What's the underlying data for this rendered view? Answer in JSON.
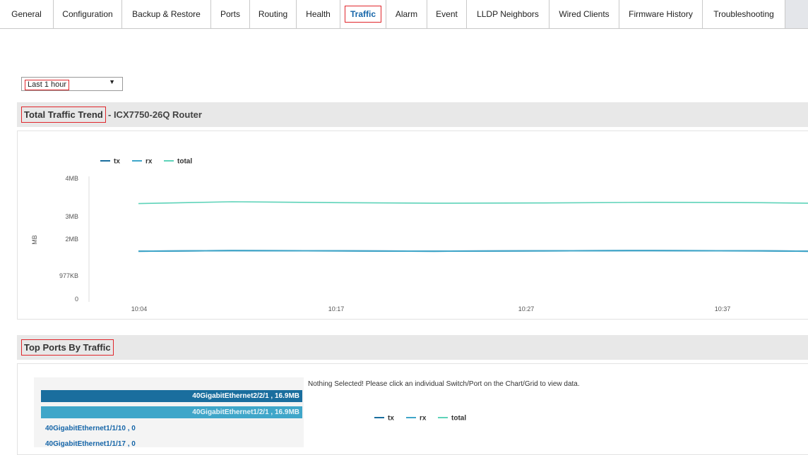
{
  "tabs": [
    {
      "label": "General",
      "active": false
    },
    {
      "label": "Configuration",
      "active": false
    },
    {
      "label": "Backup & Restore",
      "active": false
    },
    {
      "label": "Ports",
      "active": false
    },
    {
      "label": "Routing",
      "active": false
    },
    {
      "label": "Health",
      "active": false
    },
    {
      "label": "Traffic",
      "active": true
    },
    {
      "label": "Alarm",
      "active": false
    },
    {
      "label": "Event",
      "active": false
    },
    {
      "label": "LLDP Neighbors",
      "active": false
    },
    {
      "label": "Wired Clients",
      "active": false
    },
    {
      "label": "Firmware History",
      "active": false
    },
    {
      "label": "Troubleshooting",
      "active": false
    }
  ],
  "time_range": {
    "value": "Last 1 hour"
  },
  "traffic_trend": {
    "title": "Total Traffic Trend",
    "subtitle": "- ICX7750-26Q Router"
  },
  "top_ports": {
    "title": "Top Ports By Traffic",
    "message": "Nothing Selected! Please click an individual Switch/Port on the Chart/Grid to view data.",
    "ports": [
      {
        "label": "40GigabitEthernet2/2/1 , 16.9MB",
        "value_mb": 16.9
      },
      {
        "label": "40GigabitEthernet1/2/1 , 16.9MB",
        "value_mb": 16.9
      },
      {
        "label": "40GigabitEthernet1/1/10 , 0",
        "value_mb": 0
      },
      {
        "label": "40GigabitEthernet1/1/17 , 0",
        "value_mb": 0
      }
    ]
  },
  "colors": {
    "tx": "#1a6e9e",
    "rx": "#3fa6c9",
    "total": "#5ed3b9",
    "accent_red": "#e0262b",
    "active_tab": "#1565a8"
  },
  "chart_data": {
    "type": "line",
    "ylabel": "MB",
    "yticks": [
      "0",
      "977KB",
      "2MB",
      "3MB",
      "4MB"
    ],
    "xticks": [
      "10:04",
      "10:17",
      "10:27",
      "10:37"
    ],
    "ylim_mb": [
      0,
      4
    ],
    "x_range_min": [
      0,
      43
    ],
    "legend": [
      "tx",
      "rx",
      "total"
    ],
    "series": [
      {
        "name": "tx",
        "x": [
          0,
          6,
          13,
          19,
          26,
          33,
          40,
          43
        ],
        "values": [
          1.58,
          1.6,
          1.59,
          1.58,
          1.59,
          1.6,
          1.59,
          1.58
        ]
      },
      {
        "name": "rx",
        "x": [
          0,
          6,
          13,
          19,
          26,
          33,
          40,
          43
        ],
        "values": [
          1.58,
          1.6,
          1.59,
          1.58,
          1.59,
          1.6,
          1.59,
          1.58
        ]
      },
      {
        "name": "total",
        "x": [
          0,
          6,
          13,
          19,
          26,
          33,
          40,
          43
        ],
        "values": [
          3.15,
          3.21,
          3.18,
          3.16,
          3.17,
          3.19,
          3.18,
          3.16
        ]
      }
    ],
    "legend2": [
      "tx",
      "rx",
      "total"
    ]
  }
}
